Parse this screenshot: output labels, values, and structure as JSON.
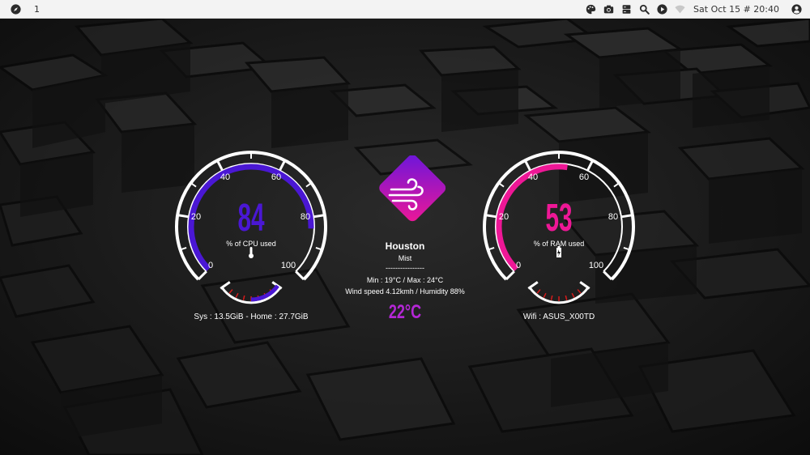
{
  "topbar": {
    "workspace": "1",
    "clock": "Sat Oct 15 # 20:40",
    "icons": [
      "compass-icon",
      "palette-icon",
      "camera-icon",
      "drive-icon",
      "search-icon",
      "play-icon",
      "wifi-icon",
      "user-icon"
    ]
  },
  "cpu": {
    "value": "84",
    "caption": "% of CPU used",
    "ticks": [
      "0",
      "20",
      "40",
      "60",
      "80",
      "100"
    ],
    "usage_percent": 84,
    "temperature_fill": 0.5,
    "footer": "Sys : 13.5GiB - Home : 27.7GiB",
    "accent": "#4a17d4"
  },
  "weather": {
    "city": "Houston",
    "condition": "Mist",
    "divider": "----------------",
    "minmax": "Min : 19°C / Max : 24°C",
    "details": "Wind speed 4.12kmh / Humidity 88%",
    "temperature": "22°C",
    "icon": "wind-icon",
    "accent": "#b427d6"
  },
  "ram": {
    "value": "53",
    "caption": "% of RAM used",
    "ticks": [
      "0",
      "20",
      "40",
      "60",
      "80",
      "100"
    ],
    "usage_percent": 53,
    "footer": "Wifi : ASUS_X00TD",
    "accent": "#ee1796"
  }
}
